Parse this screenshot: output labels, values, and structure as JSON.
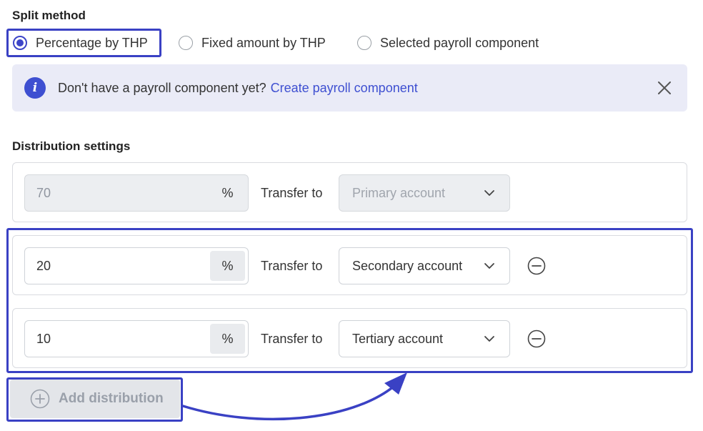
{
  "split_method": {
    "title": "Split method",
    "options": [
      {
        "label": "Percentage by THP",
        "checked": true
      },
      {
        "label": "Fixed amount by THP",
        "checked": false
      },
      {
        "label": "Selected payroll component",
        "checked": false
      }
    ]
  },
  "info_banner": {
    "text": "Don't have a payroll component yet?",
    "link": "Create payroll component",
    "icon": "info-icon",
    "close_icon": "close-icon"
  },
  "distribution": {
    "title": "Distribution settings",
    "rows": [
      {
        "value": "70",
        "unit": "%",
        "transfer_label": "Transfer to",
        "account": "Primary account",
        "disabled": true
      },
      {
        "value": "20",
        "unit": "%",
        "transfer_label": "Transfer to",
        "account": "Secondary account",
        "disabled": false
      },
      {
        "value": "10",
        "unit": "%",
        "transfer_label": "Transfer to",
        "account": "Tertiary account",
        "disabled": false
      }
    ],
    "add_label": "Add distribution"
  },
  "colors": {
    "accent": "#3e4fd1",
    "highlight": "#3a41c4",
    "banner_bg": "#eaebf7"
  }
}
